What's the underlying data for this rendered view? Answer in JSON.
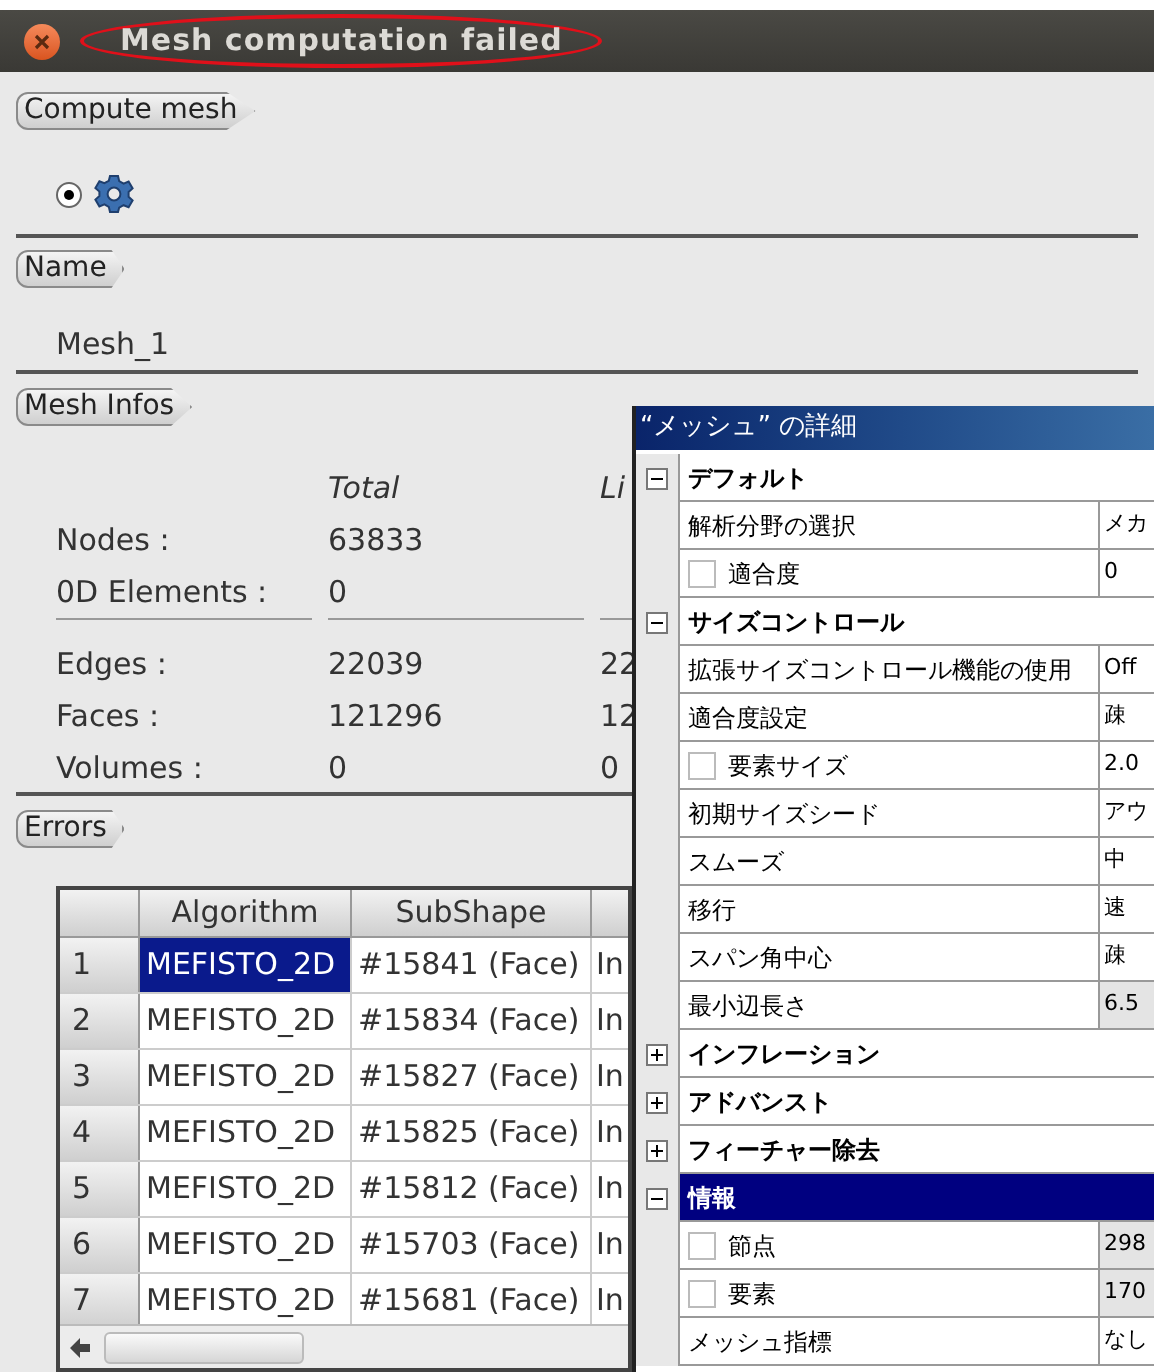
{
  "window": {
    "title": "Mesh computation failed"
  },
  "compute_mesh": {
    "label": "Compute mesh",
    "radio_selected": true
  },
  "name_group": {
    "label": "Name",
    "value": "Mesh_1"
  },
  "mesh_infos": {
    "label": "Mesh Infos",
    "columns": [
      "Total",
      "Li"
    ],
    "groups": [
      [
        {
          "label": "Nodes :",
          "values": [
            "63833"
          ]
        },
        {
          "label": "0D Elements :",
          "values": [
            "0"
          ]
        }
      ],
      [
        {
          "label": "Edges :",
          "values": [
            "22039",
            "22"
          ]
        },
        {
          "label": "Faces :",
          "values": [
            "121296",
            "12"
          ]
        },
        {
          "label": "Volumes :",
          "values": [
            "0",
            "0"
          ]
        }
      ]
    ]
  },
  "errors": {
    "label": "Errors",
    "columns": [
      "Algorithm",
      "SubShape"
    ],
    "rows": [
      {
        "number": "1",
        "algorithm": "MEFISTO_2D",
        "subshape": "#15841 (Face)",
        "column_3": "In",
        "selected": true
      },
      {
        "number": "2",
        "algorithm": "MEFISTO_2D",
        "subshape": "#15834 (Face)",
        "column_3": "In",
        "selected": false
      },
      {
        "number": "3",
        "algorithm": "MEFISTO_2D",
        "subshape": "#15827 (Face)",
        "column_3": "In",
        "selected": false
      },
      {
        "number": "4",
        "algorithm": "MEFISTO_2D",
        "subshape": "#15825 (Face)",
        "column_3": "In",
        "selected": false
      },
      {
        "number": "5",
        "algorithm": "MEFISTO_2D",
        "subshape": "#15812 (Face)",
        "column_3": "In",
        "selected": false
      },
      {
        "number": "6",
        "algorithm": "MEFISTO_2D",
        "subshape": "#15703 (Face)",
        "column_3": "In",
        "selected": false
      },
      {
        "number": "7",
        "algorithm": "MEFISTO_2D",
        "subshape": "#15681 (Face)",
        "column_3": "In",
        "selected": false
      }
    ]
  },
  "details_panel": {
    "title": "“メッシュ” の詳細",
    "rows": [
      {
        "kind": "category",
        "label": "デフォルト",
        "expanded": true,
        "selected": false
      },
      {
        "kind": "property",
        "label": "解析分野の選択",
        "value": "メカ",
        "readonly": false
      },
      {
        "kind": "checkbox",
        "label": "適合度",
        "value": "0",
        "checked": false,
        "readonly": false
      },
      {
        "kind": "category",
        "label": "サイズコントロール",
        "expanded": true,
        "selected": false
      },
      {
        "kind": "property",
        "label": "拡張サイズコントロール機能の使用",
        "value": "Off",
        "readonly": false
      },
      {
        "kind": "property",
        "label": "適合度設定",
        "value": "疎",
        "readonly": false
      },
      {
        "kind": "checkbox",
        "label": "要素サイズ",
        "value": "2.0",
        "checked": false,
        "readonly": false
      },
      {
        "kind": "property",
        "label": "初期サイズシード",
        "value": "アウ",
        "readonly": false
      },
      {
        "kind": "property",
        "label": "スムーズ",
        "value": "中",
        "readonly": false
      },
      {
        "kind": "property",
        "label": "移行",
        "value": "速",
        "readonly": false
      },
      {
        "kind": "property",
        "label": "スパン角中心",
        "value": "疎",
        "readonly": false
      },
      {
        "kind": "property",
        "label": "最小辺長さ",
        "value": "6.5",
        "readonly": true
      },
      {
        "kind": "category",
        "label": "インフレーション",
        "expanded": false,
        "selected": false
      },
      {
        "kind": "category",
        "label": "アドバンスト",
        "expanded": false,
        "selected": false
      },
      {
        "kind": "category",
        "label": "フィーチャー除去",
        "expanded": false,
        "selected": false
      },
      {
        "kind": "category",
        "label": "情報",
        "expanded": true,
        "selected": true
      },
      {
        "kind": "checkbox",
        "label": "節点",
        "value": "298",
        "checked": false,
        "readonly": true
      },
      {
        "kind": "checkbox",
        "label": "要素",
        "value": "170",
        "checked": false,
        "readonly": true
      },
      {
        "kind": "property",
        "label": "メッシュ指標",
        "value": "なし",
        "readonly": false
      }
    ]
  }
}
